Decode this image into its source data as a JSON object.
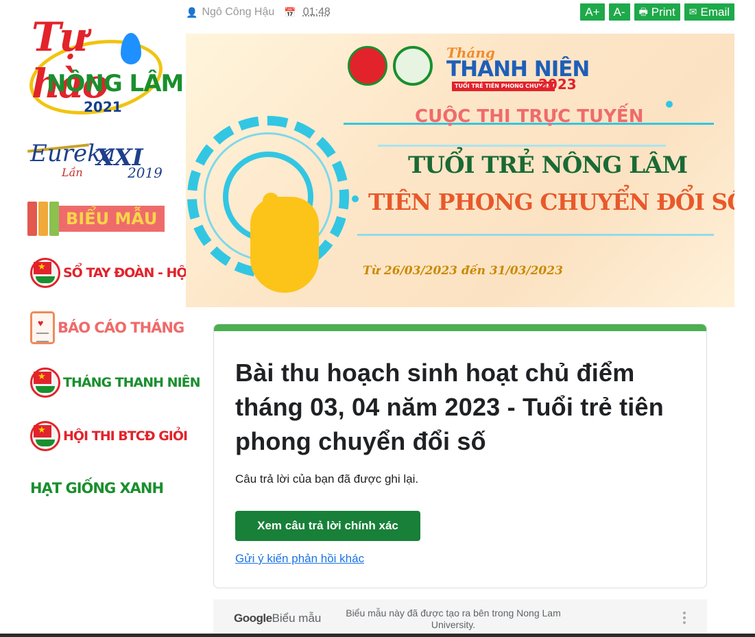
{
  "sidebar": {
    "tuhao": {
      "line1": "Tự hào",
      "line2": "NÔNG LÂM",
      "year": "2021"
    },
    "eureka": {
      "name": "Eureka",
      "lan": "Lần",
      "roman": "XXI",
      "year": "2019"
    },
    "bieumau": {
      "label": "BIỂU MẪU"
    },
    "items": [
      {
        "label": "SỔ TAY ĐOÀN - HỘI"
      },
      {
        "label": "BÁO CÁO THÁNG"
      },
      {
        "label": "THÁNG THANH NIÊN"
      },
      {
        "label": "HỘI THI BTCĐ GIỎI"
      },
      {
        "label": "HẠT GIỐNG XANH"
      }
    ]
  },
  "meta": {
    "author": "Ngô Công Hậu",
    "time": "01:48"
  },
  "tools": {
    "font_up": "A+",
    "font_down": "A-",
    "print": "Print",
    "email": "Email"
  },
  "banner": {
    "thang_script": "Tháng",
    "thang_big": "THANH NIÊN",
    "thang_year": "2023",
    "thang_sub": "TUỔI TRẺ TIÊN PHONG CHUYỂN ĐỔI SỐ",
    "cuoc_thi": "CUỘC THI TRỰC TUYẾN",
    "title1": "TUỔI TRẺ NÔNG LÂM",
    "title2": "TIÊN PHONG CHUYỂN ĐỔI SỐ",
    "dates": "Từ 26/03/2023 đến 31/03/2023"
  },
  "form": {
    "title": "Bài thu hoạch sinh hoạt chủ điểm tháng 03, 04 năm 2023 - Tuổi trẻ tiên phong chuyển đổi số",
    "confirmation": "Câu trả lời của bạn đã được ghi lại.",
    "view_score_button": "Xem câu trả lời chính xác",
    "resubmit_link": "Gửi ý kiến phản hồi khác",
    "accent_color": "#4caf50",
    "button_color": "#188038"
  },
  "footer": {
    "brand": "Google",
    "product": "Biểu mẫu",
    "note": "Biểu mẫu này đã được tạo ra bên trong Nong Lam University."
  },
  "icons": {
    "author": "user-icon",
    "time": "calendar-icon",
    "print": "printer-icon",
    "email": "envelope-icon",
    "more": "more-vertical-icon"
  }
}
